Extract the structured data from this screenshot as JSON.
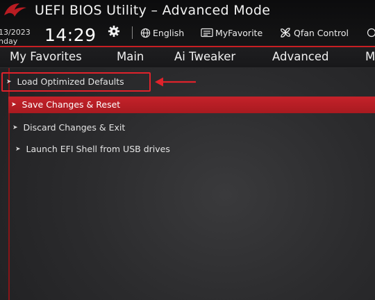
{
  "header": {
    "title": "UEFI BIOS Utility – Advanced Mode",
    "date": "13/2023",
    "day": "nday",
    "time": "14:29",
    "tools": {
      "english": "English",
      "my_favorite": "MyFavorite",
      "qfan": "Qfan Control"
    }
  },
  "menu": {
    "tabs": [
      "My Favorites",
      "Main",
      "Ai Tweaker",
      "Advanced",
      "M"
    ]
  },
  "items": {
    "load_defaults": "Load Optimized Defaults",
    "save_reset": "Save Changes & Reset",
    "discard_exit": "Discard Changes & Exit",
    "launch_efi": "Launch EFI Shell from USB drives"
  },
  "icons": {
    "arrow": "➤",
    "settings": "gear-icon",
    "language": "globe-icon",
    "favorite": "myfavorite-icon",
    "fan": "fan-icon"
  },
  "colors": {
    "accent_red": "#c81f23",
    "annotation_red": "#e0222b",
    "background": "#2b2b2d"
  }
}
